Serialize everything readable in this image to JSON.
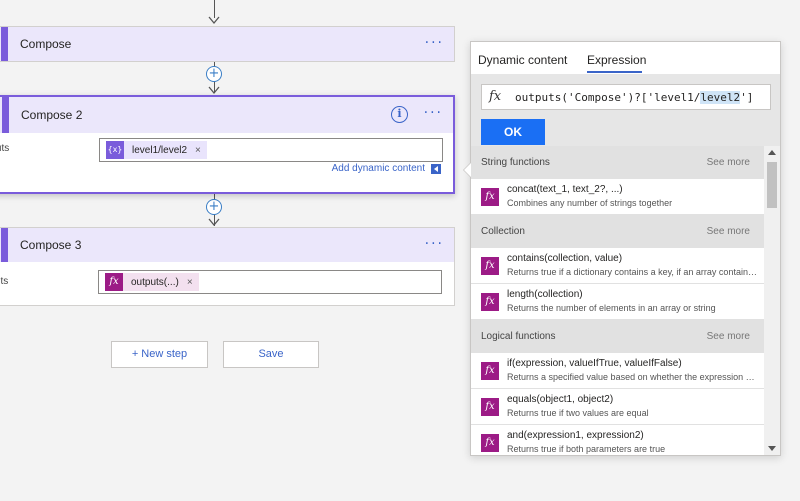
{
  "flow": {
    "steps": [
      {
        "title": "Compose"
      },
      {
        "title": "Compose 2",
        "field_label": "Inputs",
        "token_icon": "{x}",
        "token_label": "level1/level2",
        "token_remove": "×",
        "add_dynamic": "Add dynamic content"
      },
      {
        "title": "Compose 3",
        "field_label": "Inputs",
        "token_icon": "fx",
        "token_label": "outputs(...)",
        "token_remove": "×"
      }
    ],
    "menu_glyph": "···",
    "info_glyph": "i",
    "plus_glyph": "+"
  },
  "actions": {
    "new_step": "+ New step",
    "save": "Save"
  },
  "panel": {
    "tabs": [
      {
        "label": "Dynamic content"
      },
      {
        "label": "Expression",
        "active": true
      }
    ],
    "expression": {
      "fx_glyph": "fx",
      "text_before": "outputs('Compose')?['level1/",
      "text_selected": "level2",
      "text_after": "']"
    },
    "ok_label": "OK",
    "sections": [
      {
        "name": "String functions",
        "see_more": "See more",
        "items": [
          {
            "signature": "concat(text_1, text_2?, ...)",
            "description": "Combines any number of strings together"
          }
        ]
      },
      {
        "name": "Collection",
        "see_more": "See more",
        "items": [
          {
            "signature": "contains(collection, value)",
            "description": "Returns true if a dictionary contains a key, if an array contains a value, or if a string contains a substring"
          },
          {
            "signature": "length(collection)",
            "description": "Returns the number of elements in an array or string"
          }
        ]
      },
      {
        "name": "Logical functions",
        "see_more": "See more",
        "items": [
          {
            "signature": "if(expression, valueIfTrue, valueIfFalse)",
            "description": "Returns a specified value based on whether the expression resulted in true or false"
          },
          {
            "signature": "equals(object1, object2)",
            "description": "Returns true if two values are equal"
          },
          {
            "signature": "and(expression1, expression2)",
            "description": "Returns true if both parameters are true"
          }
        ]
      }
    ]
  },
  "colors": {
    "accent": "#7a5cdb",
    "link": "#3a64c8",
    "ok_button": "#1a6ff4",
    "fx_icon": "#9c1b86"
  }
}
